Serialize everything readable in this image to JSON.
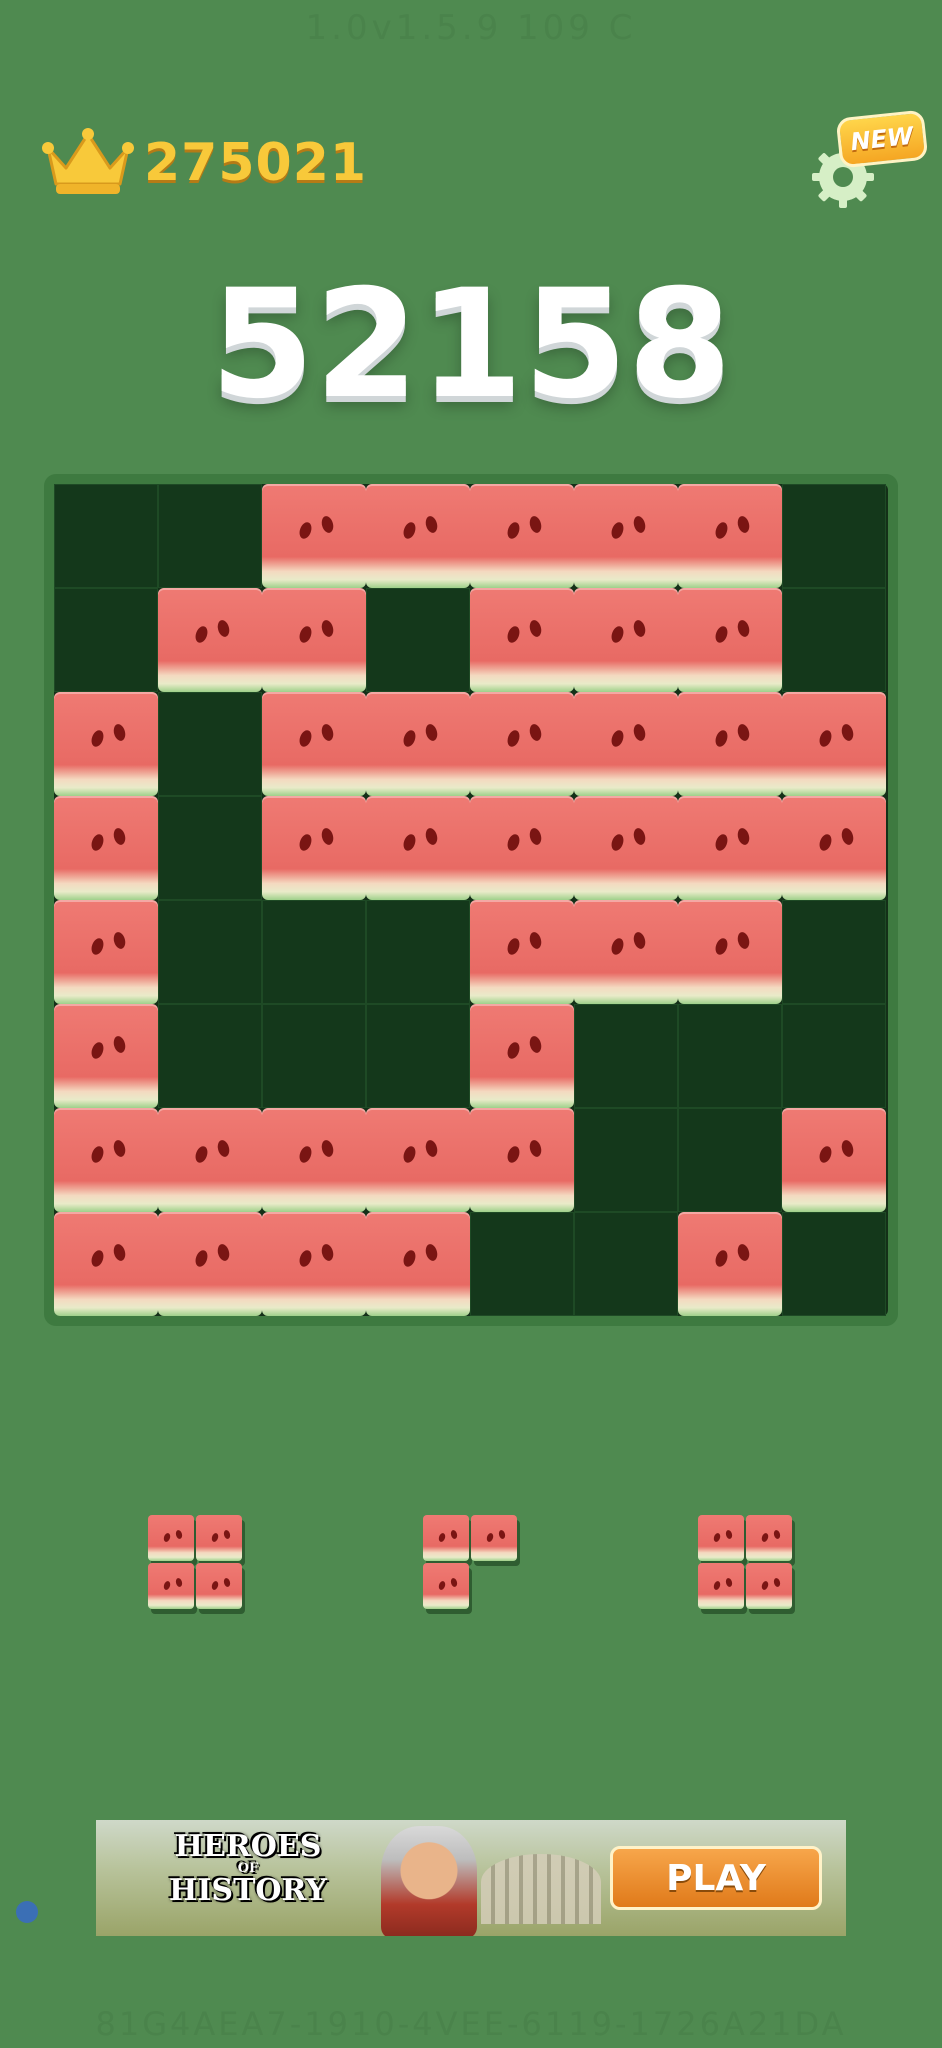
{
  "version_text": "1.0v1.5.9 109 C",
  "best_score": "275021",
  "current_score": "52158",
  "settings": {
    "badge": "NEW"
  },
  "board": {
    "rows": 8,
    "cols": 8,
    "cells": [
      [
        0,
        0,
        1,
        1,
        1,
        1,
        1,
        0
      ],
      [
        0,
        1,
        1,
        0,
        1,
        1,
        1,
        0
      ],
      [
        1,
        0,
        1,
        1,
        1,
        1,
        1,
        1
      ],
      [
        1,
        0,
        1,
        1,
        1,
        1,
        1,
        1
      ],
      [
        1,
        0,
        0,
        0,
        1,
        1,
        1,
        0
      ],
      [
        1,
        0,
        0,
        0,
        1,
        0,
        0,
        0
      ],
      [
        1,
        1,
        1,
        1,
        1,
        0,
        0,
        1
      ],
      [
        1,
        1,
        1,
        1,
        0,
        0,
        1,
        0
      ]
    ]
  },
  "pieces": [
    {
      "name": "piece-square-left",
      "cells": [
        [
          1,
          1
        ],
        [
          1,
          1
        ]
      ]
    },
    {
      "name": "piece-corner-middle",
      "cells": [
        [
          1,
          1
        ],
        [
          1,
          0
        ]
      ]
    },
    {
      "name": "piece-square-right",
      "cells": [
        [
          1,
          1
        ],
        [
          1,
          1
        ]
      ]
    }
  ],
  "ad": {
    "title_line1": "HEROES",
    "title_of": "OF",
    "title_line2": "HISTORY",
    "cta": "PLAY"
  },
  "device_id": "81G4AEA7-1910-4VEE-6119-1726A21DA"
}
